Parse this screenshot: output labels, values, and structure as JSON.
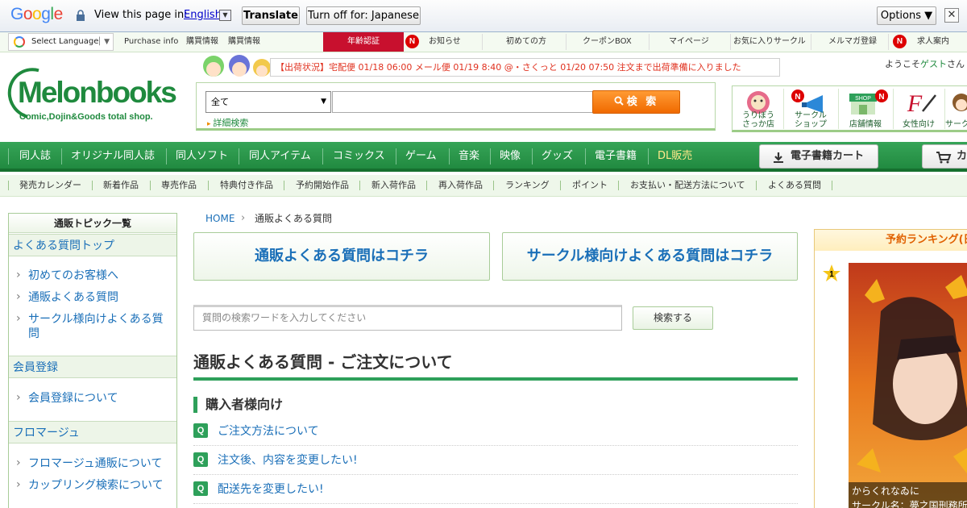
{
  "translate_bar": {
    "view_label": "View this page in:",
    "language": "English",
    "translate_label": "Translate",
    "turn_off_label": "Turn off for: Japanese",
    "options_label": "Options ▼",
    "close_label": "✕"
  },
  "top_nav": {
    "select_language": "Select Language",
    "items": [
      "Purchase info",
      "購買情報",
      "購買情報",
      "年齢認証",
      "お知らせ",
      "初めての方",
      "クーポンBOX",
      "マイページ",
      "お気に入りサークル",
      "メルマガ登録",
      "求人案内"
    ],
    "badge": "N"
  },
  "header": {
    "logo_main": "Melonbooks",
    "logo_tag": "Comic,Dojin&Goods total shop.",
    "notice": "【出荷状況】宅配便 01/18 06:00 メール便 01/19 8:40 @・さくっと 01/20 07:50 注文まで出荷準備に入りました",
    "category": "全て",
    "search_label": "検 索",
    "advanced": "詳細検索",
    "welcome_prefix": "ようこそ",
    "welcome_guest": "ゲスト",
    "welcome_suffix": "さん"
  },
  "icon_nav": [
    "うりぼう\nさっか店",
    "サークル\nショップ",
    "店舗情報",
    "女性向け",
    "サーク"
  ],
  "main_nav": {
    "items": [
      "同人誌",
      "オリジナル同人誌",
      "同人ソフト",
      "同人アイテム",
      "コミックス",
      "ゲーム",
      "音楽",
      "映像",
      "グッズ",
      "電子書籍",
      "DL販売"
    ],
    "ebook_cart": "電子書籍カート",
    "cart": "カ"
  },
  "sub_nav": [
    "発売カレンダー",
    "新着作品",
    "専売作品",
    "特典付き作品",
    "予約開始作品",
    "新入荷作品",
    "再入荷作品",
    "ランキング",
    "ポイント",
    "お支払い・配送方法について",
    "よくある質問"
  ],
  "sidebar": {
    "title": "通販トピック一覧",
    "sections": [
      {
        "head": "よくある質問トップ",
        "links": [
          "初めてのお客様へ",
          "通販よくある質問",
          "サークル様向けよくある質問"
        ]
      },
      {
        "head": "会員登録",
        "links": [
          "会員登録について"
        ]
      },
      {
        "head": "フロマージュ",
        "links": [
          "フロマージュ通販について",
          "カップリング検索について"
        ]
      }
    ]
  },
  "breadcrumb": {
    "home": "HOME",
    "sep": "›",
    "current": "通販よくある質問"
  },
  "main": {
    "faq_button": "通販よくある質問はコチラ",
    "circle_button": "サークル様向けよくある質問はコチラ",
    "search_placeholder": "質問の検索ワードを入力してください",
    "search_button": "検索する",
    "page_title": "通販よくある質問 - ご注文について",
    "section_title": "購入者様向け",
    "q_badge": "Q",
    "questions": [
      "ご注文方法について",
      "注文後、内容を変更したい!",
      "配送先を変更したい!"
    ]
  },
  "ranking": {
    "title": "予約ランキング(日",
    "rank": "1",
    "item_title": "からくれなゐに",
    "item_circle": "サークル名：夢之国刑務所"
  },
  "colors": {
    "brand_green": "#1f8a3e",
    "link_blue": "#1a6fb8",
    "accent_orange": "#f06a00",
    "age_red": "#c8102e"
  }
}
